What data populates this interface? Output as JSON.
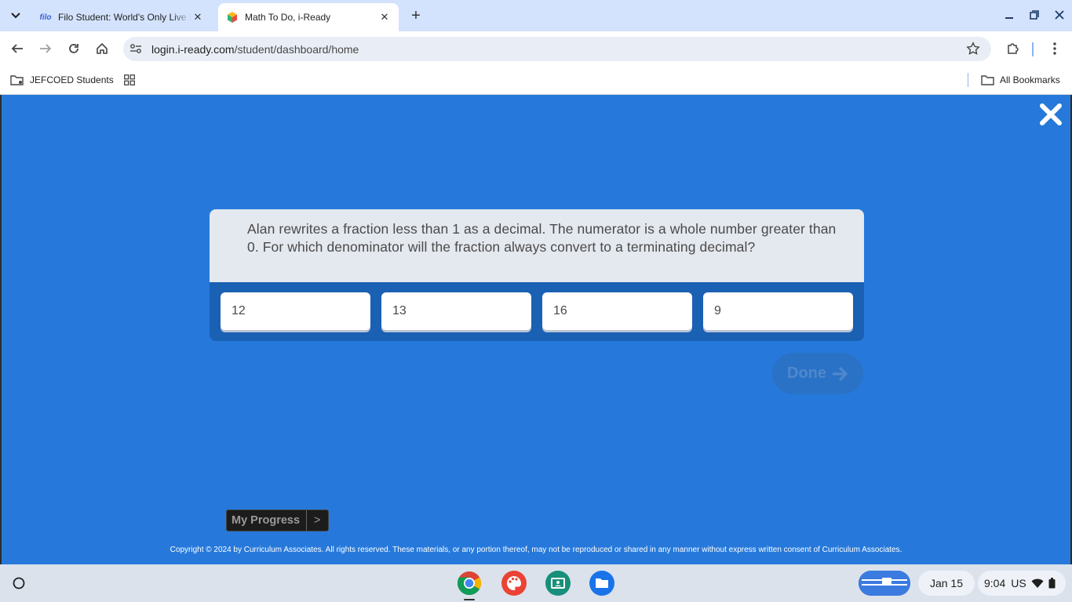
{
  "browser": {
    "tabs": [
      {
        "favicon_text": "filo",
        "title": "Filo Student: World's Only Live Instant Tutoring App"
      },
      {
        "title": "Math To Do, i-Ready"
      }
    ],
    "url_host": "login.i-ready.com",
    "url_path": "/student/dashboard/home",
    "bookmarks": [
      {
        "label": "JEFCOED Students"
      }
    ],
    "all_bookmarks_label": "All Bookmarks"
  },
  "lesson": {
    "question": "Alan rewrites a fraction less than 1 as a decimal. The numerator is a whole number greater than 0. For which denominator will the fraction always convert to a terminating decimal?",
    "answers": [
      "12",
      "13",
      "16",
      "9"
    ],
    "done_label": "Done",
    "progress_label": "My Progress",
    "progress_chevron": ">",
    "copyright": "Copyright © 2024 by Curriculum Associates. All rights reserved. These materials, or any portion thereof, may not be reproduced or shared in any manner without express written consent of Curriculum Associates."
  },
  "shelf": {
    "date": "Jan 15",
    "time": "9:04",
    "locale": "US"
  },
  "colors": {
    "content_bg": "#2679db",
    "answer_bar": "#1a60b3",
    "question_bg": "#e4e8ef"
  }
}
